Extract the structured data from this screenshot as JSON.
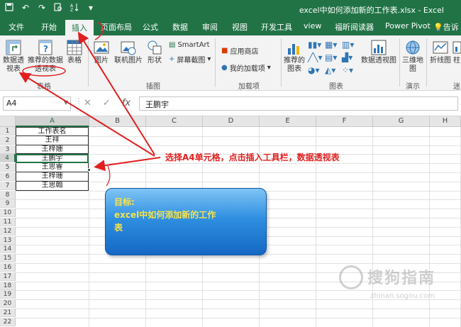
{
  "window": {
    "title": "excel中如何添加新的工作表.xlsx  -  Excel",
    "qat_icons": [
      "save-icon",
      "undo-icon",
      "redo-icon",
      "print-preview-icon",
      "sort-icon",
      "customize-icon"
    ]
  },
  "tabs": [
    {
      "label": "文件"
    },
    {
      "label": "开始"
    },
    {
      "label": "插入"
    },
    {
      "label": "页面布局"
    },
    {
      "label": "公式"
    },
    {
      "label": "数据"
    },
    {
      "label": "审阅"
    },
    {
      "label": "视图"
    },
    {
      "label": "开发工具"
    },
    {
      "label": "view"
    },
    {
      "label": "福昕阅读器"
    },
    {
      "label": "Power Pivot"
    },
    {
      "label": "告诉"
    }
  ],
  "ribbon": {
    "pivot_table": "数据透视表",
    "recommended_pivot": "推荐的数据透视表",
    "table": "表格",
    "tables_group": "表格",
    "picture": "图片",
    "online_picture": "联机图片",
    "shapes": "形状",
    "smartart": "SmartArt",
    "screenshot": "屏幕截图",
    "illustrations_group": "插图",
    "store": "应用商店",
    "my_addins": "我的加载项",
    "addins_group": "加载项",
    "recommended_charts": "推荐的图表",
    "pivot_chart": "数据透视图",
    "charts_group": "图表",
    "map_3d": "三维地图",
    "tours_group": "演示",
    "line": "折线图",
    "sparkline_partial": "柱",
    "sparklines_partial": "迷"
  },
  "formula_bar": {
    "name_box": "A4",
    "cancel": "✕",
    "enter": "✓",
    "fx": "fx",
    "value": "王鹏宇"
  },
  "columns": [
    "A",
    "B",
    "C",
    "D",
    "E",
    "F",
    "G",
    "H"
  ],
  "rows": [
    "1",
    "2",
    "3",
    "4",
    "5",
    "6",
    "7",
    "8",
    "9",
    "10",
    "11",
    "12",
    "13",
    "14",
    "15",
    "16",
    "17",
    "18",
    "19",
    "20",
    "21",
    "22"
  ],
  "cells_A": [
    "工作表名",
    "王祥",
    "王梓姗",
    "王鹏宇",
    "王思睿",
    "王梓珊",
    "王思翰"
  ],
  "annotation": "选择A4单元格，点击插入工具栏，数据透视表",
  "callout": {
    "line1": "目标:",
    "line2": "excel中如何添加新的工作",
    "line3": "表"
  },
  "watermark": {
    "brand": "搜狗指南",
    "url": "zhinan.sogou.com"
  },
  "colors": {
    "excel_green": "#217346",
    "annotation_red": "#e02020",
    "callout_text": "#f8e34a"
  }
}
